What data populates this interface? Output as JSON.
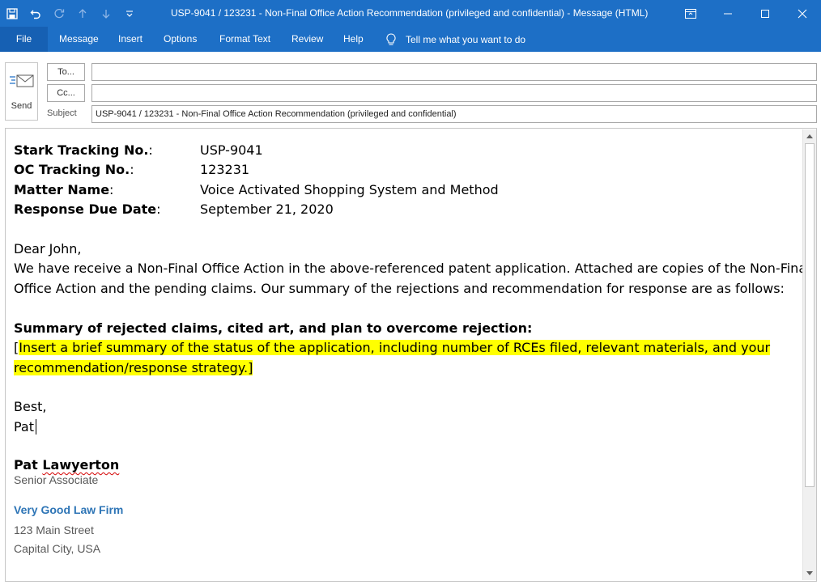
{
  "titlebar": {
    "title": "USP-9041 / 123231 - Non-Final Office Action Recommendation (privileged and confidential)  -  Message (HTML)"
  },
  "quick_access": {
    "icons": [
      "save-icon",
      "undo-icon",
      "redo-icon",
      "arrow-up-icon",
      "arrow-down-icon",
      "customize-icon"
    ]
  },
  "window_controls": {
    "icons": [
      "ribbon-display-icon",
      "minimize-icon",
      "maximize-icon",
      "close-icon"
    ]
  },
  "ribbon": {
    "tabs": [
      {
        "label": "File"
      },
      {
        "label": "Message"
      },
      {
        "label": "Insert"
      },
      {
        "label": "Options"
      },
      {
        "label": "Format Text"
      },
      {
        "label": "Review"
      },
      {
        "label": "Help"
      }
    ],
    "tell_me": "Tell me what you want to do"
  },
  "header": {
    "send_label": "Send",
    "to_label": "To...",
    "cc_label": "Cc...",
    "to_value": "",
    "cc_value": "",
    "subject_label": "Subject",
    "subject_value": "USP-9041 / 123231 - Non-Final Office Action Recommendation (privileged and confidential)"
  },
  "body": {
    "fields": [
      {
        "key": "Stark Tracking No.",
        "sep": ":",
        "value": "USP-9041"
      },
      {
        "key": "OC Tracking No.",
        "sep": ":",
        "value": "123231"
      },
      {
        "key": "Matter Name",
        "sep": ":",
        "value": "Voice Activated Shopping System and Method"
      },
      {
        "key": "Response Due Date",
        "sep": ":",
        "value": "September 21, 2020"
      }
    ],
    "greeting": "Dear John,",
    "para_line1": "We have receive a Non-Final Office Action in the above-referenced patent application. Attached are copies of the Non-Final",
    "para_line2": "Office Action and the pending claims. Our summary of the rejections and recommendation for response are as follows:",
    "summary_heading": "Summary of rejected claims, cited art, and plan to overcome rejection:",
    "placeholder_open": "[",
    "placeholder_line1": "Insert a brief summary of the status of the application, including number of RCEs filed, relevant materials, and your",
    "placeholder_line2": "recommendation/response strategy.]",
    "closing": "Best,",
    "sender_short": "Pat"
  },
  "signature": {
    "first_name": "Pat",
    "last_name": "Lawyerton",
    "title": "Senior Associate",
    "firm": "Very Good Law Firm",
    "address_line1": "123 Main Street",
    "address_line2": "Capital City, USA"
  },
  "colors": {
    "accent": "#1d6fc6",
    "highlight": "#ffff00",
    "firm": "#2e75b6",
    "signature_gray": "#595959"
  }
}
